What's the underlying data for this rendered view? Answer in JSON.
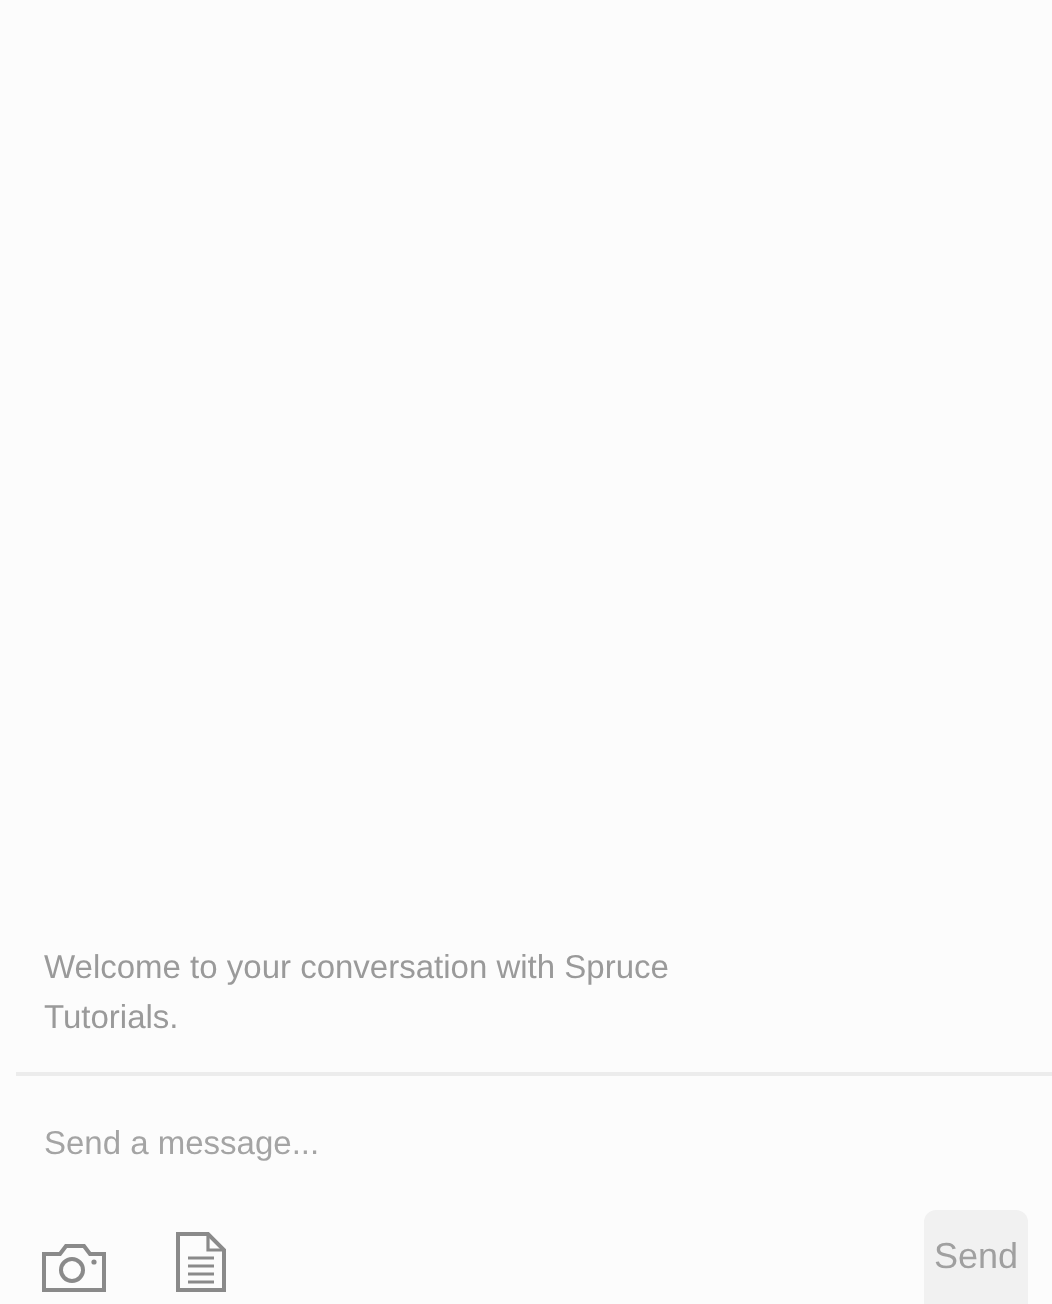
{
  "conversation": {
    "welcome": "Welcome to your conversation with Spruce Tutorials."
  },
  "composer": {
    "placeholder": "Send a message...",
    "send_button": {
      "label": "Send",
      "disabled": true
    }
  }
}
